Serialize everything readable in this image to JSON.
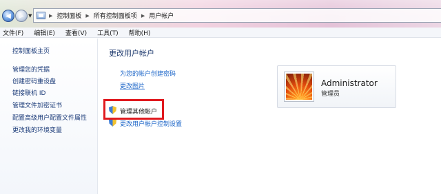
{
  "address_bar": {
    "breadcrumbs": [
      "控制面板",
      "所有控制面板项",
      "用户帐户"
    ]
  },
  "menu": {
    "items": [
      "文件(F)",
      "编辑(E)",
      "查看(V)",
      "工具(T)",
      "帮助(H)"
    ]
  },
  "left_panel": {
    "home": "控制面板主页",
    "links": [
      "管理您的凭据",
      "创建密码重设盘",
      "链接联机 ID",
      "管理文件加密证书",
      "配置高级用户配置文件属性",
      "更改我的环境变量"
    ]
  },
  "main": {
    "title": "更改用户帐户",
    "create_password": "为您的帐户创建密码",
    "change_picture": "更改图片",
    "manage_other": "管理其他帐户",
    "uac_settings": "更改用户帐户控制设置"
  },
  "account": {
    "name": "Administrator",
    "role": "管理员"
  },
  "colors": {
    "highlight": "#e0191e",
    "link": "#1b65c8"
  }
}
